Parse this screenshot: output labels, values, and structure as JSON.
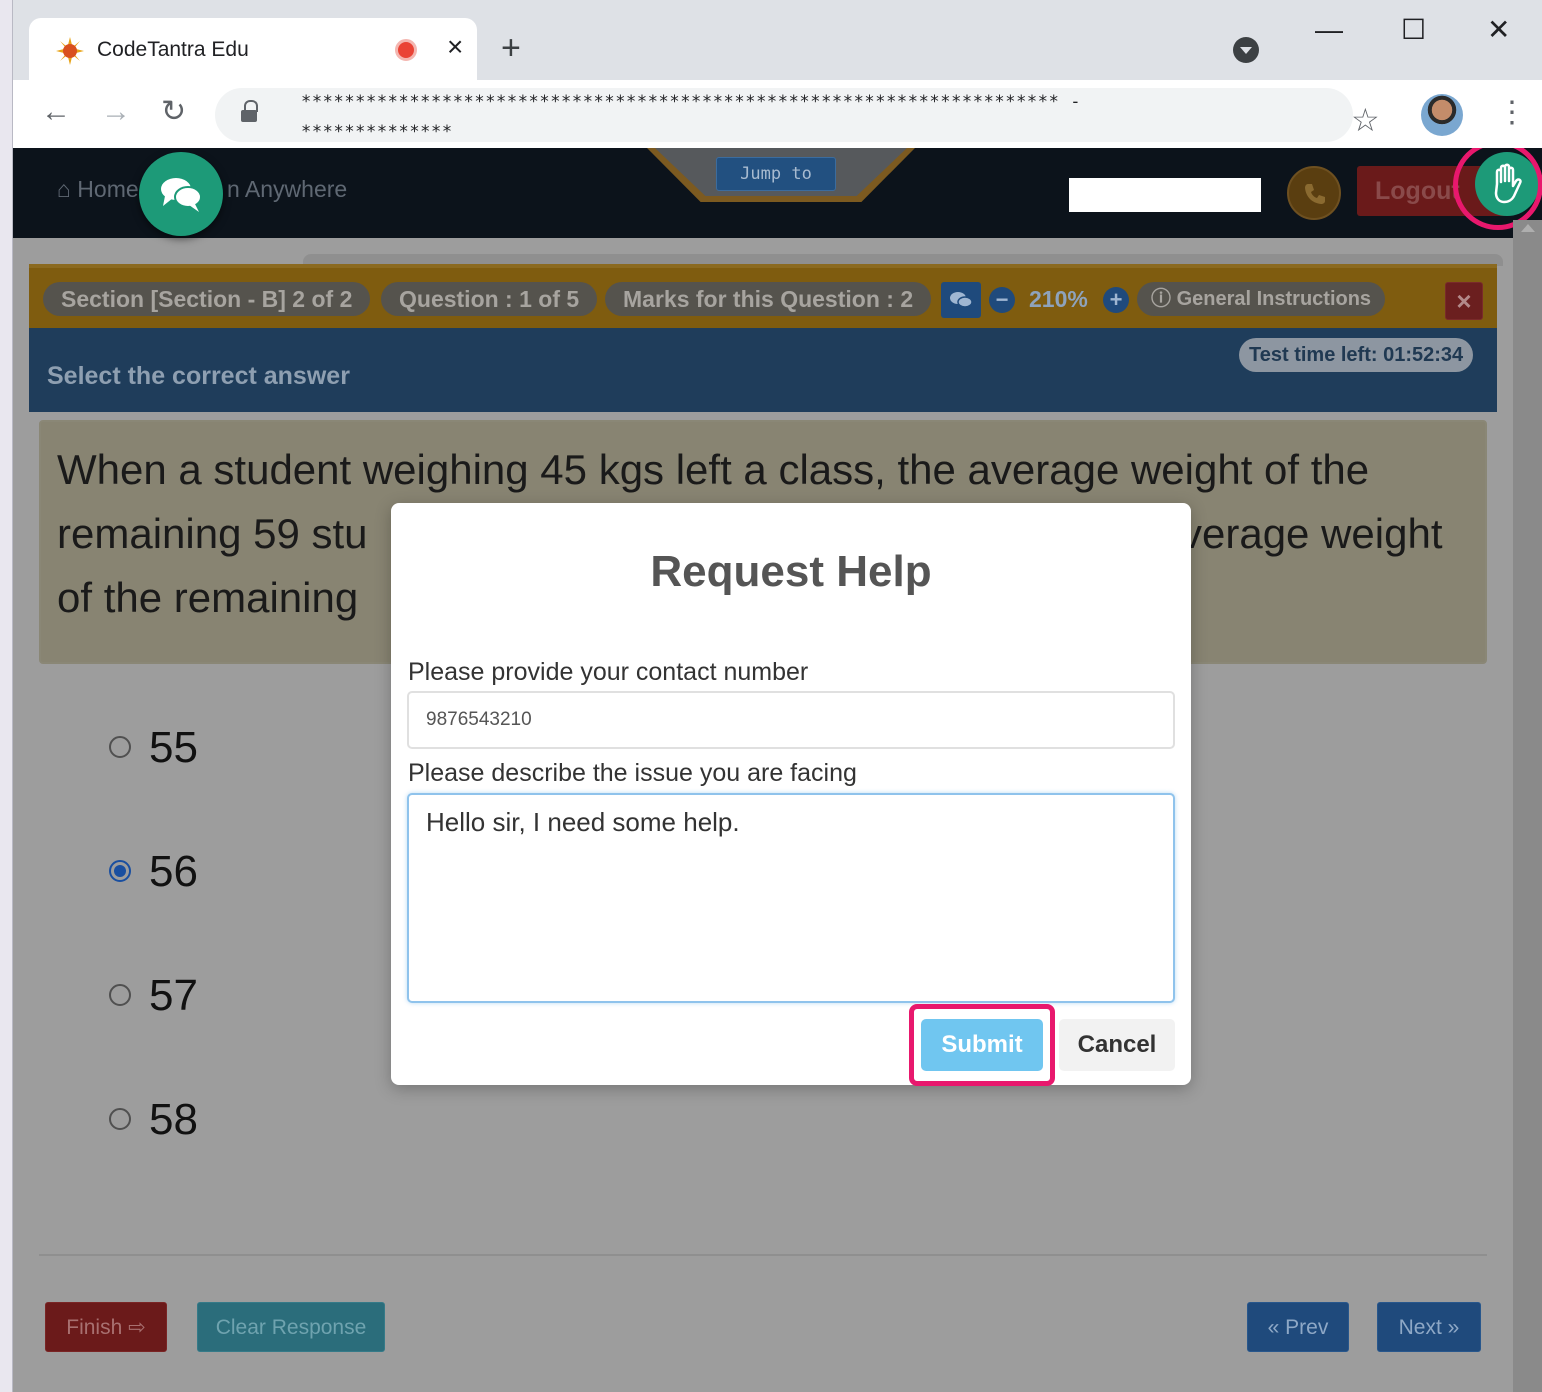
{
  "browser": {
    "tab_title": "CodeTantra Edu",
    "tab_close": "×",
    "new_tab": "+",
    "url_line1": "********************************************************************** -",
    "url_line2": "**************",
    "window_controls": {
      "minimize": "—",
      "maximize": "☐",
      "close": "✕"
    },
    "nav": {
      "back": "←",
      "forward": "→",
      "reload": "↻"
    },
    "star": "☆",
    "menu": "⋮"
  },
  "topnav": {
    "home_label": "Home",
    "anywhere_label": "n Anywhere",
    "jump_label": "Jump to",
    "logout_label": "Logout"
  },
  "exam_bar": {
    "section": "Section [Section - B] 2 of 2",
    "question": "Question : 1 of 5",
    "marks": "Marks for this Question : 2",
    "zoom_minus": "−",
    "zoom": "210%",
    "zoom_plus": "+",
    "general_instructions": "General Instructions",
    "close": "×"
  },
  "header": {
    "prompt": "Select the correct answer",
    "time_left": "Test time left: 01:52:34"
  },
  "question_text": {
    "line1": "When a student weighing 45 kgs left a class, the average weight of the",
    "line2_left": "remaining 59 stu",
    "line2_right": "verage weight",
    "line3_left": "of the remaining"
  },
  "options": [
    {
      "label": "55",
      "selected": false
    },
    {
      "label": "56",
      "selected": true
    },
    {
      "label": "57",
      "selected": false
    },
    {
      "label": "58",
      "selected": false
    }
  ],
  "footer": {
    "finish": "Finish",
    "clear": "Clear Response",
    "prev": "« Prev",
    "next": "Next »"
  },
  "modal": {
    "title": "Request Help",
    "contact_label": "Please provide your contact number",
    "contact_value": "9876543210",
    "issue_label": "Please describe the issue you are facing",
    "issue_value": "Hello sir, I need some help.",
    "submit": "Submit",
    "cancel": "Cancel"
  },
  "colors": {
    "highlight": "#e8186d",
    "fab_green": "#1d9a78",
    "submit_blue": "#70c6f0"
  }
}
